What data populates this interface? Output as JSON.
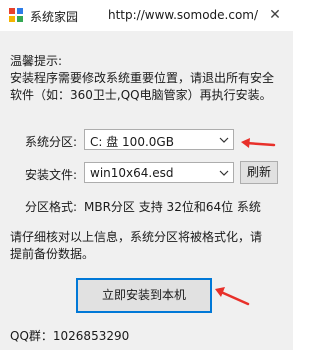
{
  "window": {
    "title": "系统家园",
    "url": "http://www.somode.com/",
    "close_glyph": "✕"
  },
  "tip": {
    "heading": "温馨提示:",
    "line1": "安装程序需要修改系统重要位置，请退出所有安全",
    "line2": "软件（如：360卫士,QQ电脑管家）再执行安装。"
  },
  "form": {
    "partition_label": "系统分区:",
    "partition_value": "C: 盘 100.0GB",
    "file_label": "安装文件:",
    "file_value": "win10x64.esd",
    "refresh_label": "刷新",
    "format_label": "分区格式:",
    "format_value": "MBR分区 支持 32位和64位 系统"
  },
  "warning": {
    "line1": "请仔细核对以上信息，系统分区将被格式化，请",
    "line2": "提前备份数据。"
  },
  "install_button": "立即安装到本机",
  "footer": {
    "qq": "QQ群：1026853290"
  },
  "colors": {
    "annotation_arrow": "#e8302a",
    "focus_border": "#0078d7"
  }
}
